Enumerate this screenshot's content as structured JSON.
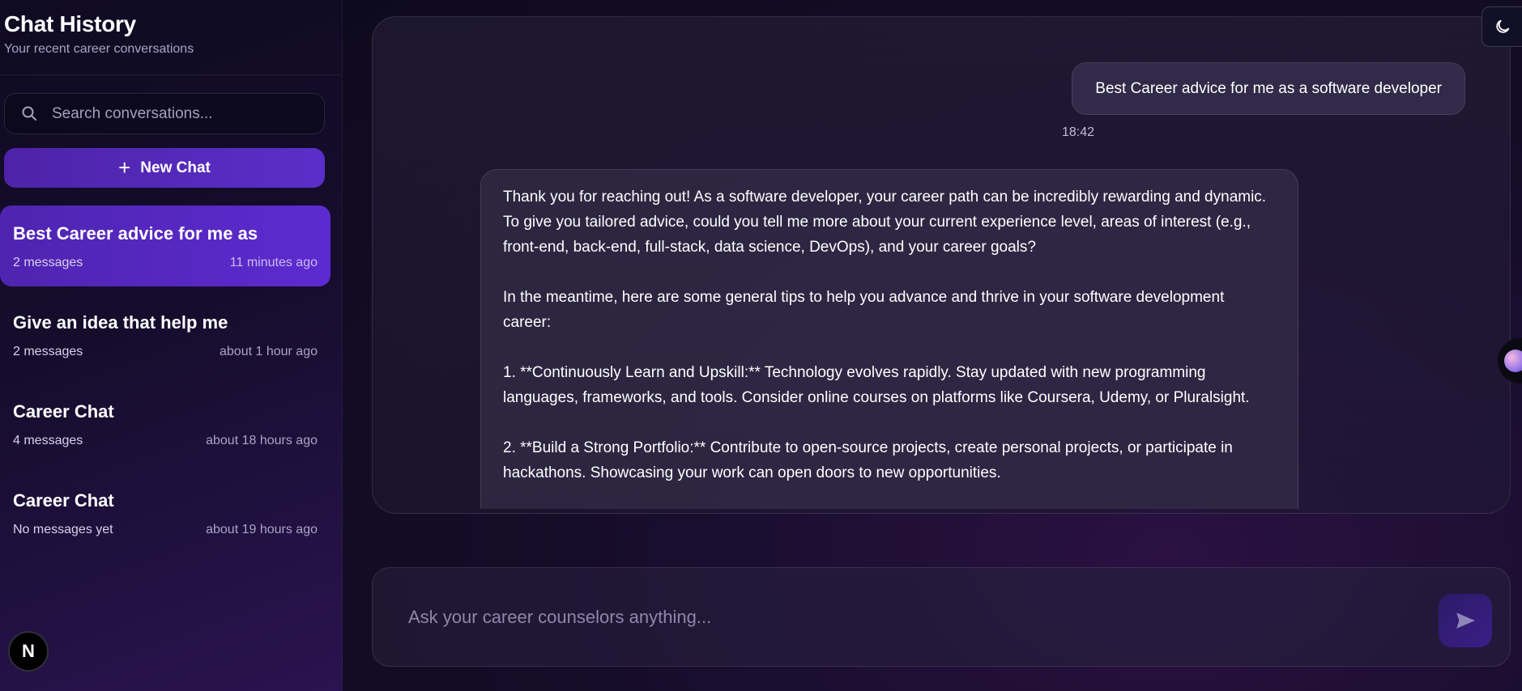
{
  "sidebar": {
    "title": "Chat History",
    "subtitle": "Your recent career conversations",
    "search_placeholder": "Search conversations...",
    "new_chat_label": "New Chat",
    "conversations": [
      {
        "title": "Best Career advice for me as",
        "count": "2 messages",
        "time": "11 minutes ago",
        "active": true
      },
      {
        "title": "Give an idea that help me",
        "count": "2 messages",
        "time": "about 1 hour ago",
        "active": false
      },
      {
        "title": "Career Chat",
        "count": "4 messages",
        "time": "about 18 hours ago",
        "active": false
      },
      {
        "title": "Career Chat",
        "count": "No messages yet",
        "time": "about 19 hours ago",
        "active": false
      }
    ],
    "badge_letter": "N"
  },
  "chat": {
    "user_message": "Best Career advice for me as a software developer",
    "user_time": "18:42",
    "bot_paragraphs": [
      "Thank you for reaching out! As a software developer, your career path can be incredibly rewarding and dynamic. To give you tailored advice, could you tell me more about your current experience level, areas of interest (e.g., front-end, back-end, full-stack, data science, DevOps), and your career goals?",
      "In the meantime, here are some general tips to help you advance and thrive in your software development career:",
      "1. **Continuously Learn and Upskill:** Technology evolves rapidly. Stay updated with new programming languages, frameworks, and tools. Consider online courses on platforms like Coursera, Udemy, or Pluralsight.",
      "2. **Build a Strong Portfolio:** Contribute to open-source projects, create personal projects, or participate in hackathons. Showcasing your work can open doors to new opportunities."
    ]
  },
  "composer": {
    "placeholder": "Ask your career counselors anything..."
  },
  "icons": {
    "search": "search-icon",
    "plus": "plus-icon",
    "send": "send-icon",
    "theme": "moon-icon"
  },
  "colors": {
    "accent": "#5a2fc9",
    "background": "#0d0a1c"
  }
}
